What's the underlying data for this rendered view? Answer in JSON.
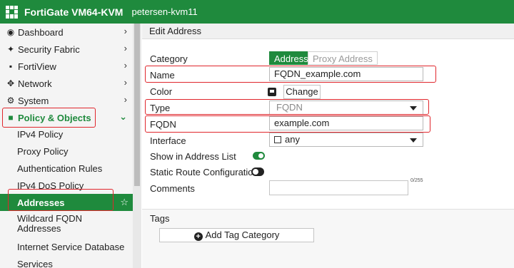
{
  "topbar": {
    "app_title": "FortiGate VM64-KVM",
    "hostname": "petersen-kvm11",
    "bg_color": "#1f8a3d"
  },
  "sidebar": {
    "items": [
      {
        "label": "Dashboard",
        "icon": "dashboard-icon"
      },
      {
        "label": "Security Fabric",
        "icon": "security-fabric-icon"
      },
      {
        "label": "FortiView",
        "icon": "fortiview-icon"
      },
      {
        "label": "Network",
        "icon": "network-icon"
      },
      {
        "label": "System",
        "icon": "gear-icon"
      },
      {
        "label": "Policy & Objects",
        "icon": "policy-objects-icon"
      }
    ],
    "subitems": [
      {
        "label": "IPv4 Policy"
      },
      {
        "label": "Proxy Policy"
      },
      {
        "label": "Authentication Rules"
      },
      {
        "label": "IPv4 DoS Policy"
      },
      {
        "label": "Addresses"
      },
      {
        "label": "Wildcard FQDN Addresses"
      },
      {
        "label": "Internet Service Database"
      },
      {
        "label": "Services"
      }
    ]
  },
  "form": {
    "header": "Edit Address",
    "category": {
      "label": "Category",
      "options": [
        "Address",
        "Proxy Address"
      ],
      "selected": "Address"
    },
    "name": {
      "label": "Name",
      "value": "FQDN_example.com"
    },
    "color": {
      "label": "Color",
      "button": "Change"
    },
    "type": {
      "label": "Type",
      "value": "FQDN"
    },
    "fqdn": {
      "label": "FQDN",
      "value": "example.com"
    },
    "interface": {
      "label": "Interface",
      "value": "any"
    },
    "show_in_list": {
      "label": "Show in Address List",
      "on": true
    },
    "static_route": {
      "label": "Static Route Configuration",
      "on": false
    },
    "comments": {
      "label": "Comments",
      "counter": "0/255",
      "value": ""
    },
    "tags": {
      "label": "Tags",
      "add_button": "Add Tag Category"
    }
  }
}
